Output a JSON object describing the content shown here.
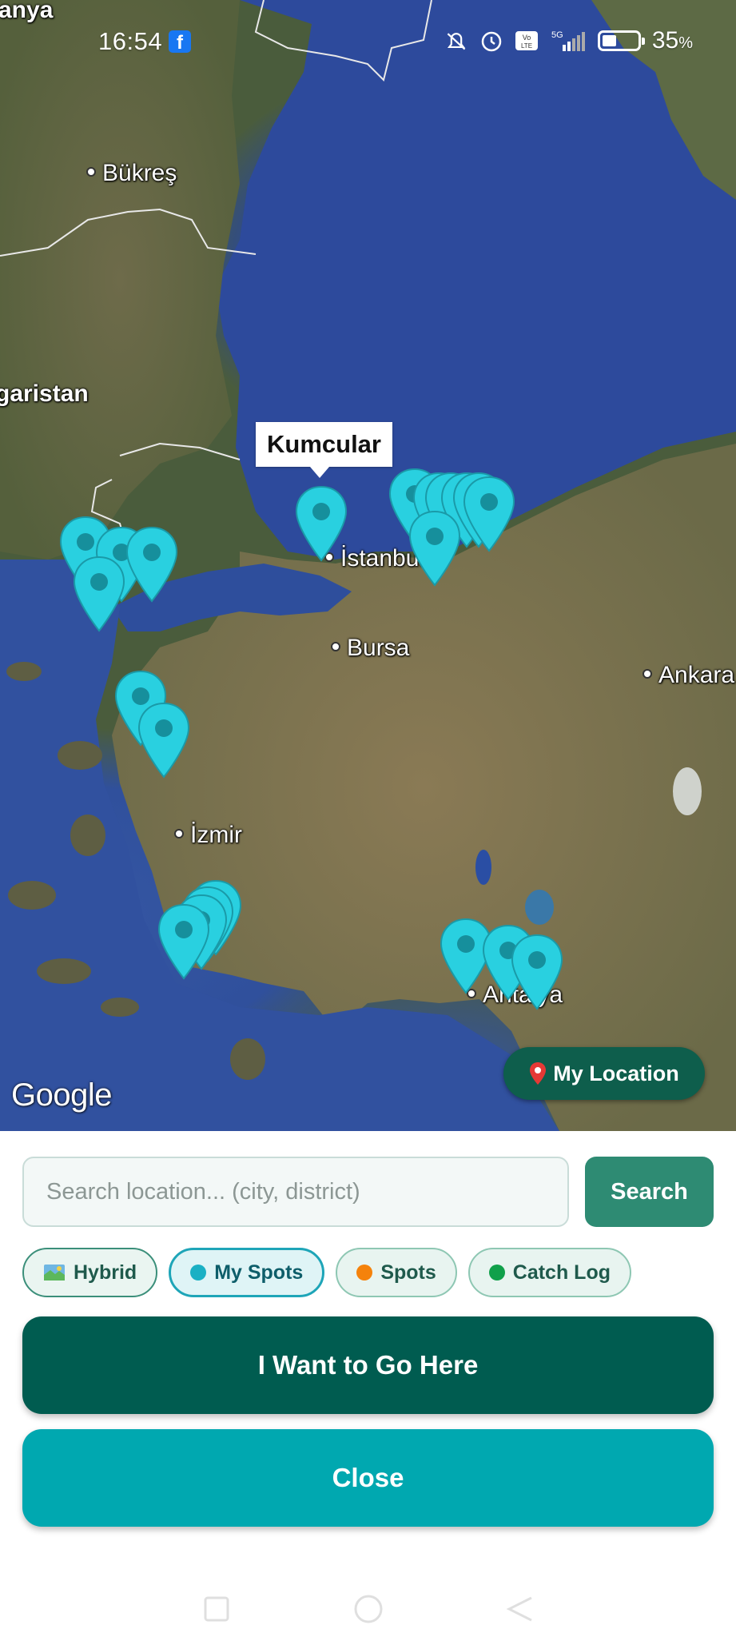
{
  "status_bar": {
    "time": "16:54",
    "network": "5G",
    "battery_percent": "35",
    "battery_unit": "%",
    "icons": [
      "facebook-icon",
      "mute-icon",
      "alarm-icon",
      "volte-icon",
      "signal-icon",
      "battery-icon"
    ]
  },
  "map": {
    "provider": "Google",
    "labels": {
      "romania_partial": "anya",
      "bucharest": "Bükreş",
      "bulgaria_partial": "garistan",
      "istanbul": "İstanbul",
      "bursa": "Bursa",
      "ankara": "Ankara",
      "izmir": "İzmir",
      "antalya": "Antalya"
    },
    "tooltip": "Kumcular",
    "pin_color": "#29d0e0",
    "my_location_label": "My Location"
  },
  "search": {
    "placeholder": "Search location... (city, district)",
    "value": "",
    "button_label": "Search"
  },
  "filters": [
    {
      "label": "Hybrid",
      "icon": "map-icon",
      "active": false
    },
    {
      "label": "My Spots",
      "dot_color": "#1ab0c4",
      "active": true
    },
    {
      "label": "Spots",
      "dot_color": "#f5820b",
      "active": false
    },
    {
      "label": "Catch Log",
      "dot_color": "#10a04a",
      "active": false
    }
  ],
  "actions": {
    "go_label": "I Want to Go Here",
    "close_label": "Close"
  },
  "colors": {
    "primary_dark": "#005c50",
    "primary_teal": "#00a8b0",
    "search_green": "#2e8b73"
  }
}
